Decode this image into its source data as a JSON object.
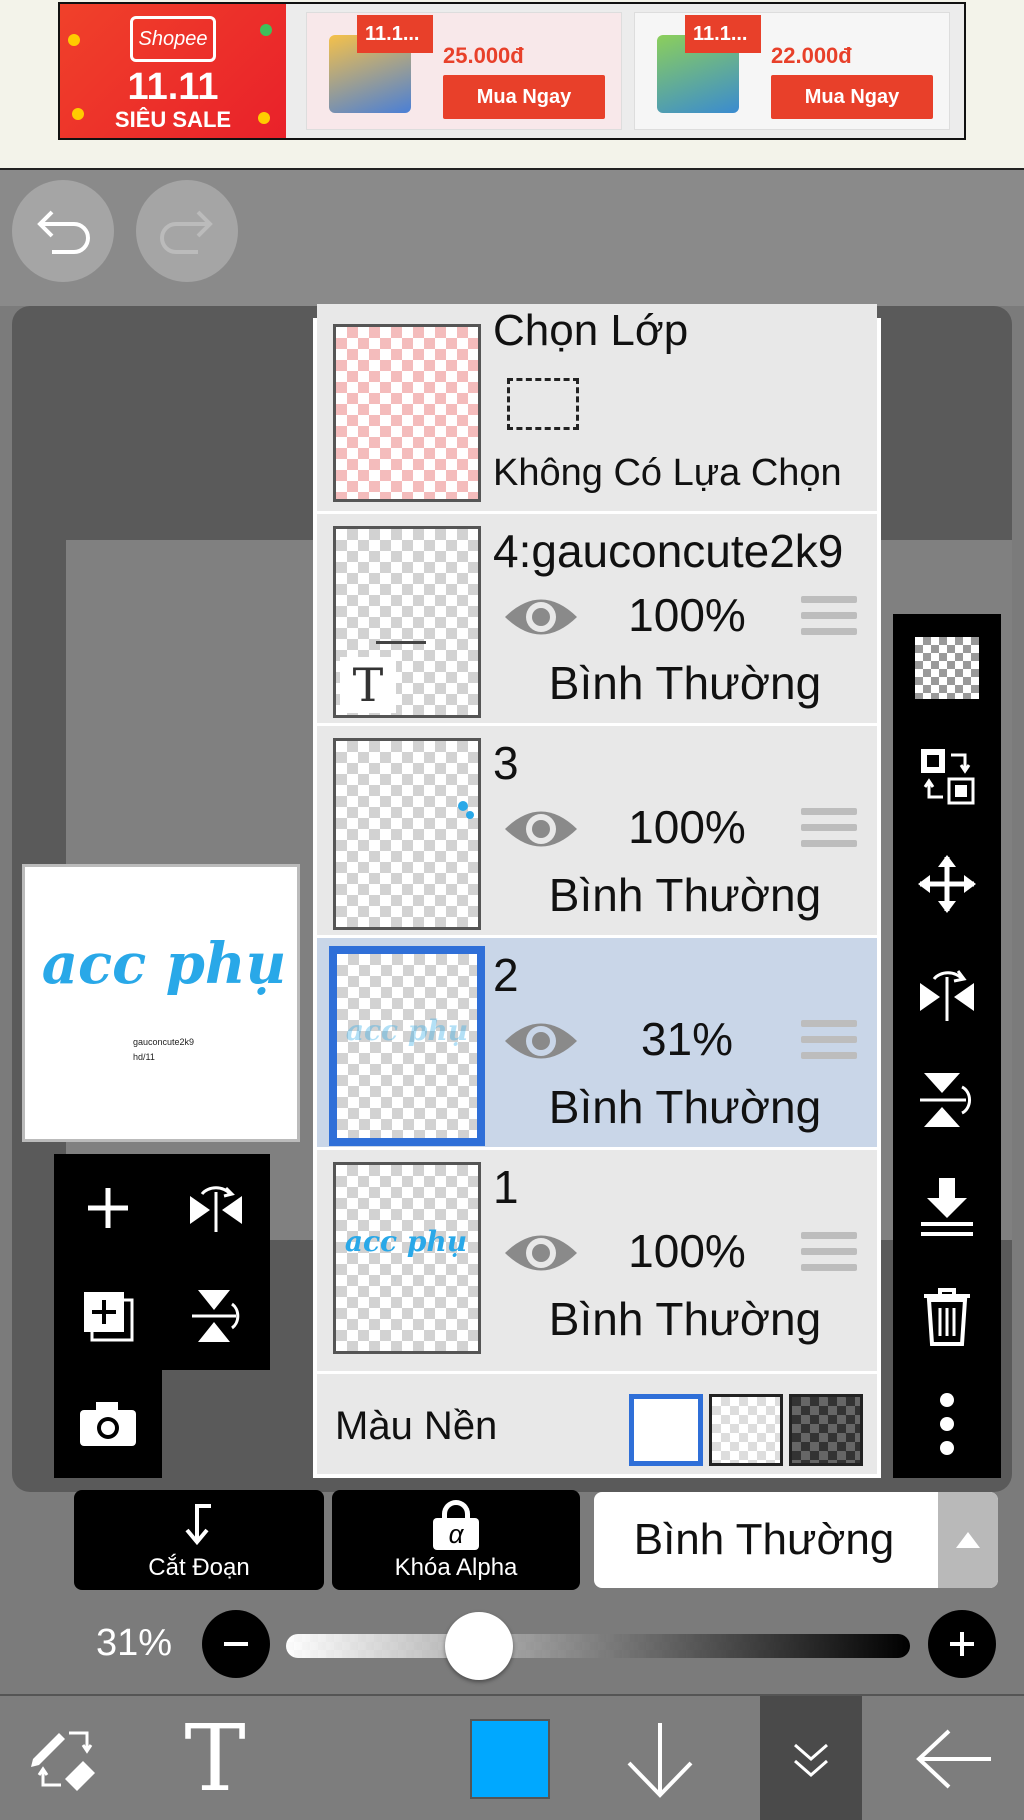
{
  "ad": {
    "brand": "Shopee",
    "sale_big": "11.11",
    "sale_small": "SIÊU SALE",
    "products": [
      {
        "tag": "11.1...",
        "price": "25.000đ",
        "button": "Mua Ngay"
      },
      {
        "tag": "11.1...",
        "price": "22.000đ",
        "button": "Mua Ngay"
      }
    ]
  },
  "history": {
    "undo_icon": "undo-arrow-icon",
    "redo_icon": "redo-arrow-icon"
  },
  "preview": {
    "art_text": "acc phụ",
    "small_line1": "gauconcute2k9",
    "small_line2": "hd/11"
  },
  "layers": {
    "selection": {
      "title": "Chọn Lớp",
      "status": "Không Có Lựa Chọn"
    },
    "items": [
      {
        "name": "4:gauconcute2k9",
        "opacity": "100%",
        "blend": "Bình Thường",
        "thumb_glyph": "T"
      },
      {
        "name": "3",
        "opacity": "100%",
        "blend": "Bình Thường"
      },
      {
        "name": "2",
        "opacity": "31%",
        "blend": "Bình Thường",
        "thumb_text": "acc phụ"
      },
      {
        "name": "1",
        "opacity": "100%",
        "blend": "Bình Thường",
        "thumb_text": "acc phụ"
      }
    ],
    "background": {
      "label": "Màu Nền"
    }
  },
  "controls": {
    "clip_label": "Cắt Đoạn",
    "alpha_lock_label": "Khóa Alpha",
    "alpha_glyph": "α",
    "blend_mode": "Bình Thường",
    "opacity_label": "31%",
    "opacity_value": 0.31
  },
  "bottom_bar": {
    "text_tool_glyph": "T",
    "color": "#00a8ff"
  },
  "colors": {
    "accent_blue": "#2f6fd8",
    "shopee_orange": "#e8402a",
    "art_blue": "#29a8e8"
  }
}
